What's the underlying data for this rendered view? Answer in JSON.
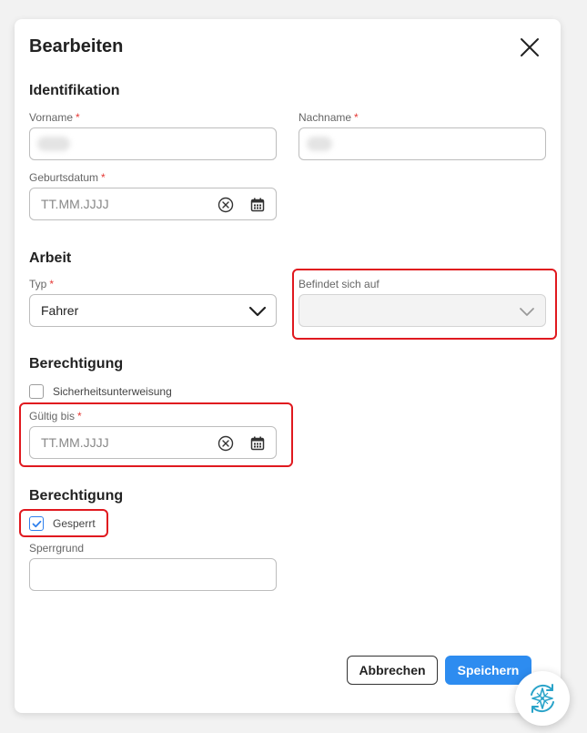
{
  "dialog": {
    "title": "Bearbeiten",
    "close_icon": "close-icon"
  },
  "identification": {
    "heading": "Identifikation",
    "firstname_label": "Vorname",
    "lastname_label": "Nachname",
    "birthdate_label": "Geburtsdatum",
    "birthdate_placeholder": "TT.MM.JJJJ",
    "required_marker": "*"
  },
  "work": {
    "heading": "Arbeit",
    "type_label": "Typ",
    "type_value": "Fahrer",
    "location_label": "Befindet sich auf",
    "location_value": ""
  },
  "permission1": {
    "heading": "Berechtigung",
    "safety_label": "Sicherheitsunterweisung",
    "safety_checked": false,
    "valid_until_label": "Gültig bis",
    "valid_until_placeholder": "TT.MM.JJJJ"
  },
  "permission2": {
    "heading": "Berechtigung",
    "blocked_label": "Gesperrt",
    "blocked_checked": true,
    "block_reason_label": "Sperrgrund",
    "block_reason_value": ""
  },
  "actions": {
    "cancel_label": "Abbrechen",
    "save_label": "Speichern"
  },
  "colors": {
    "accent": "#2d8cf0",
    "required": "#e53935",
    "highlight": "#e0191f",
    "fab_icon": "#29a3c9"
  }
}
